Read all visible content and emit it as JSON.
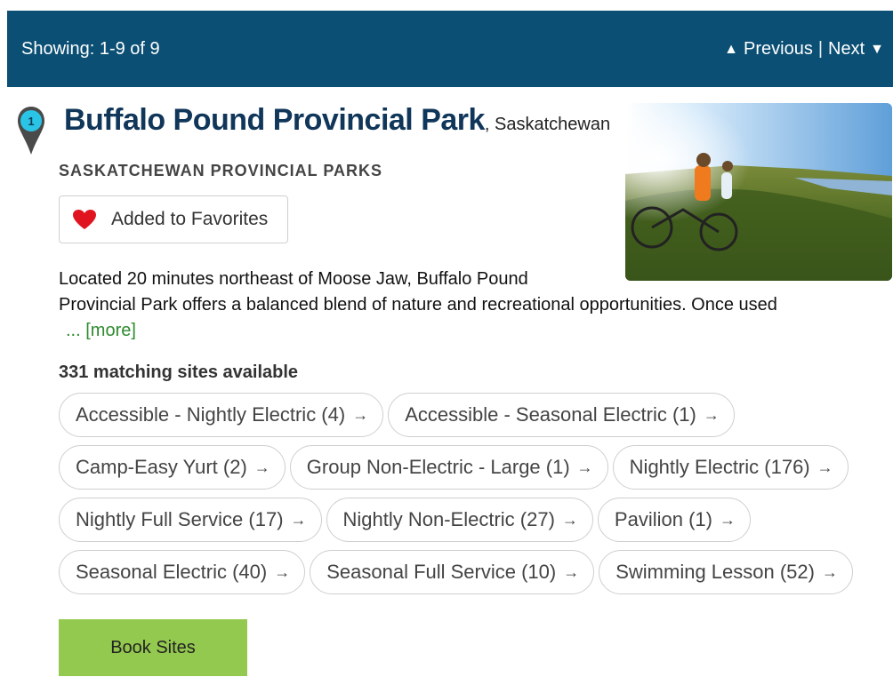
{
  "header": {
    "showing": "Showing: 1-9 of 9",
    "previous_label": "Previous",
    "separator": "|",
    "next_label": "Next",
    "background_color": "#0b4f74"
  },
  "result": {
    "pin_number": "1",
    "park_name": "Buffalo Pound Provincial Park",
    "region": ", Saskatchewan",
    "agency": "SASKATCHEWAN PROVINCIAL PARKS",
    "favorite_label": "Added to Favorites",
    "description_line1": "Located 20 minutes northeast of Moose Jaw, Buffalo Pound",
    "description_line2": "Provincial Park offers a balanced blend of nature and recreational opportunities. Once used",
    "ellipsis": "...",
    "more_label": "[more]",
    "matching_sites": "331 matching sites available",
    "site_types": [
      [
        "Accessible - Nightly Electric (4)",
        "Accessible - Seasonal Electric (1)"
      ],
      [
        "Camp-Easy Yurt (2)",
        "Group Non-Electric - Large (1)",
        "Nightly Electric (176)"
      ],
      [
        "Nightly Full Service (17)",
        "Nightly Non-Electric (27)",
        "Pavilion (1)"
      ],
      [
        "Seasonal Electric (40)",
        "Seasonal Full Service (10)",
        "Swimming Lesson (52)"
      ]
    ],
    "chip_arrow": "→",
    "book_label": "Book Sites",
    "accent_green": "#94c94f",
    "heart_color": "#e0141e",
    "pin_color": "#2ac4e6"
  }
}
